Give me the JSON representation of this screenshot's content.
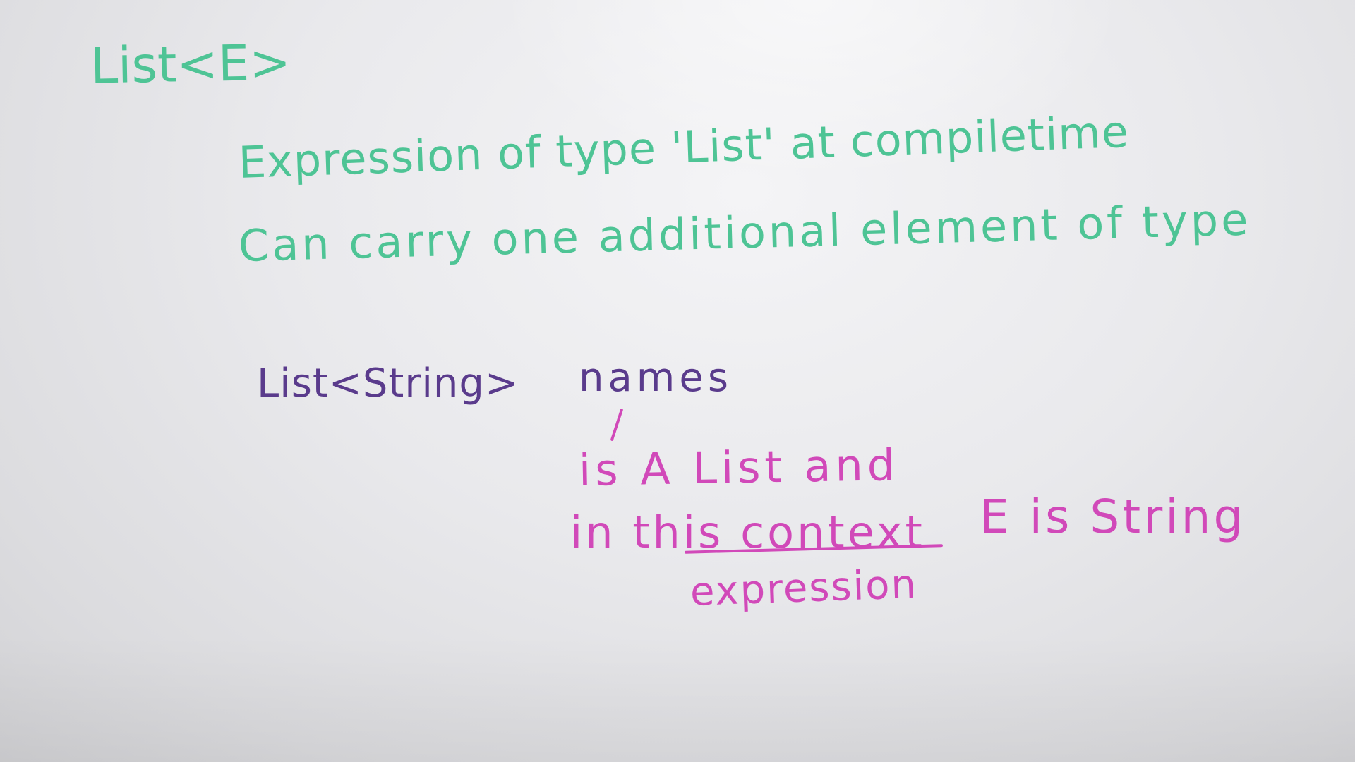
{
  "whiteboard": {
    "title": "List<E>",
    "definition": {
      "line1": "Expression of type 'List' at compiletime",
      "line2": "Can carry one additional element of type"
    },
    "example": {
      "declaration_type": "List<String>",
      "declaration_name": "names"
    },
    "notes": {
      "line1": "is A List and",
      "line2_part1": "in this context",
      "line2_part2": "E is String",
      "line3": "expression"
    },
    "colors": {
      "green_marker": "#4ec495",
      "purple_marker": "#5a3b8c",
      "magenta_marker": "#d149b9"
    }
  }
}
